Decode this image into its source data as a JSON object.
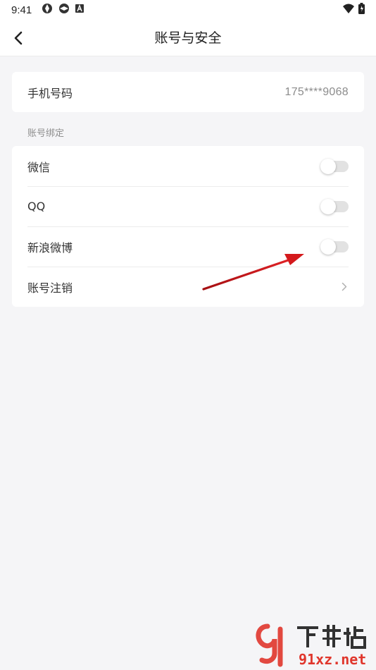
{
  "status_bar": {
    "time": "9:41",
    "icons": [
      "aperture-icon",
      "aperture-icon",
      "a-badge-icon",
      "wifi-icon",
      "battery-icon"
    ]
  },
  "app_bar": {
    "title": "账号与安全",
    "back_icon": "chevron-left-icon"
  },
  "phone": {
    "label": "手机号码",
    "value": "175****9068"
  },
  "bindings": {
    "section_label": "账号绑定",
    "items": [
      {
        "label": "微信",
        "type": "toggle",
        "enabled": false
      },
      {
        "label": "QQ",
        "type": "toggle",
        "enabled": false
      },
      {
        "label": "新浪微博",
        "type": "toggle",
        "enabled": false
      },
      {
        "label": "账号注销",
        "type": "link",
        "icon": "chevron-right-icon"
      }
    ]
  },
  "colors": {
    "background": "#f5f5f7",
    "card": "#ffffff",
    "toggle_off": "#e2e2e2",
    "annotation_arrow": "#d4191c",
    "watermark_red": "#e0362c"
  },
  "watermark": {
    "logo": "91下载站",
    "url": "91xz.net"
  }
}
